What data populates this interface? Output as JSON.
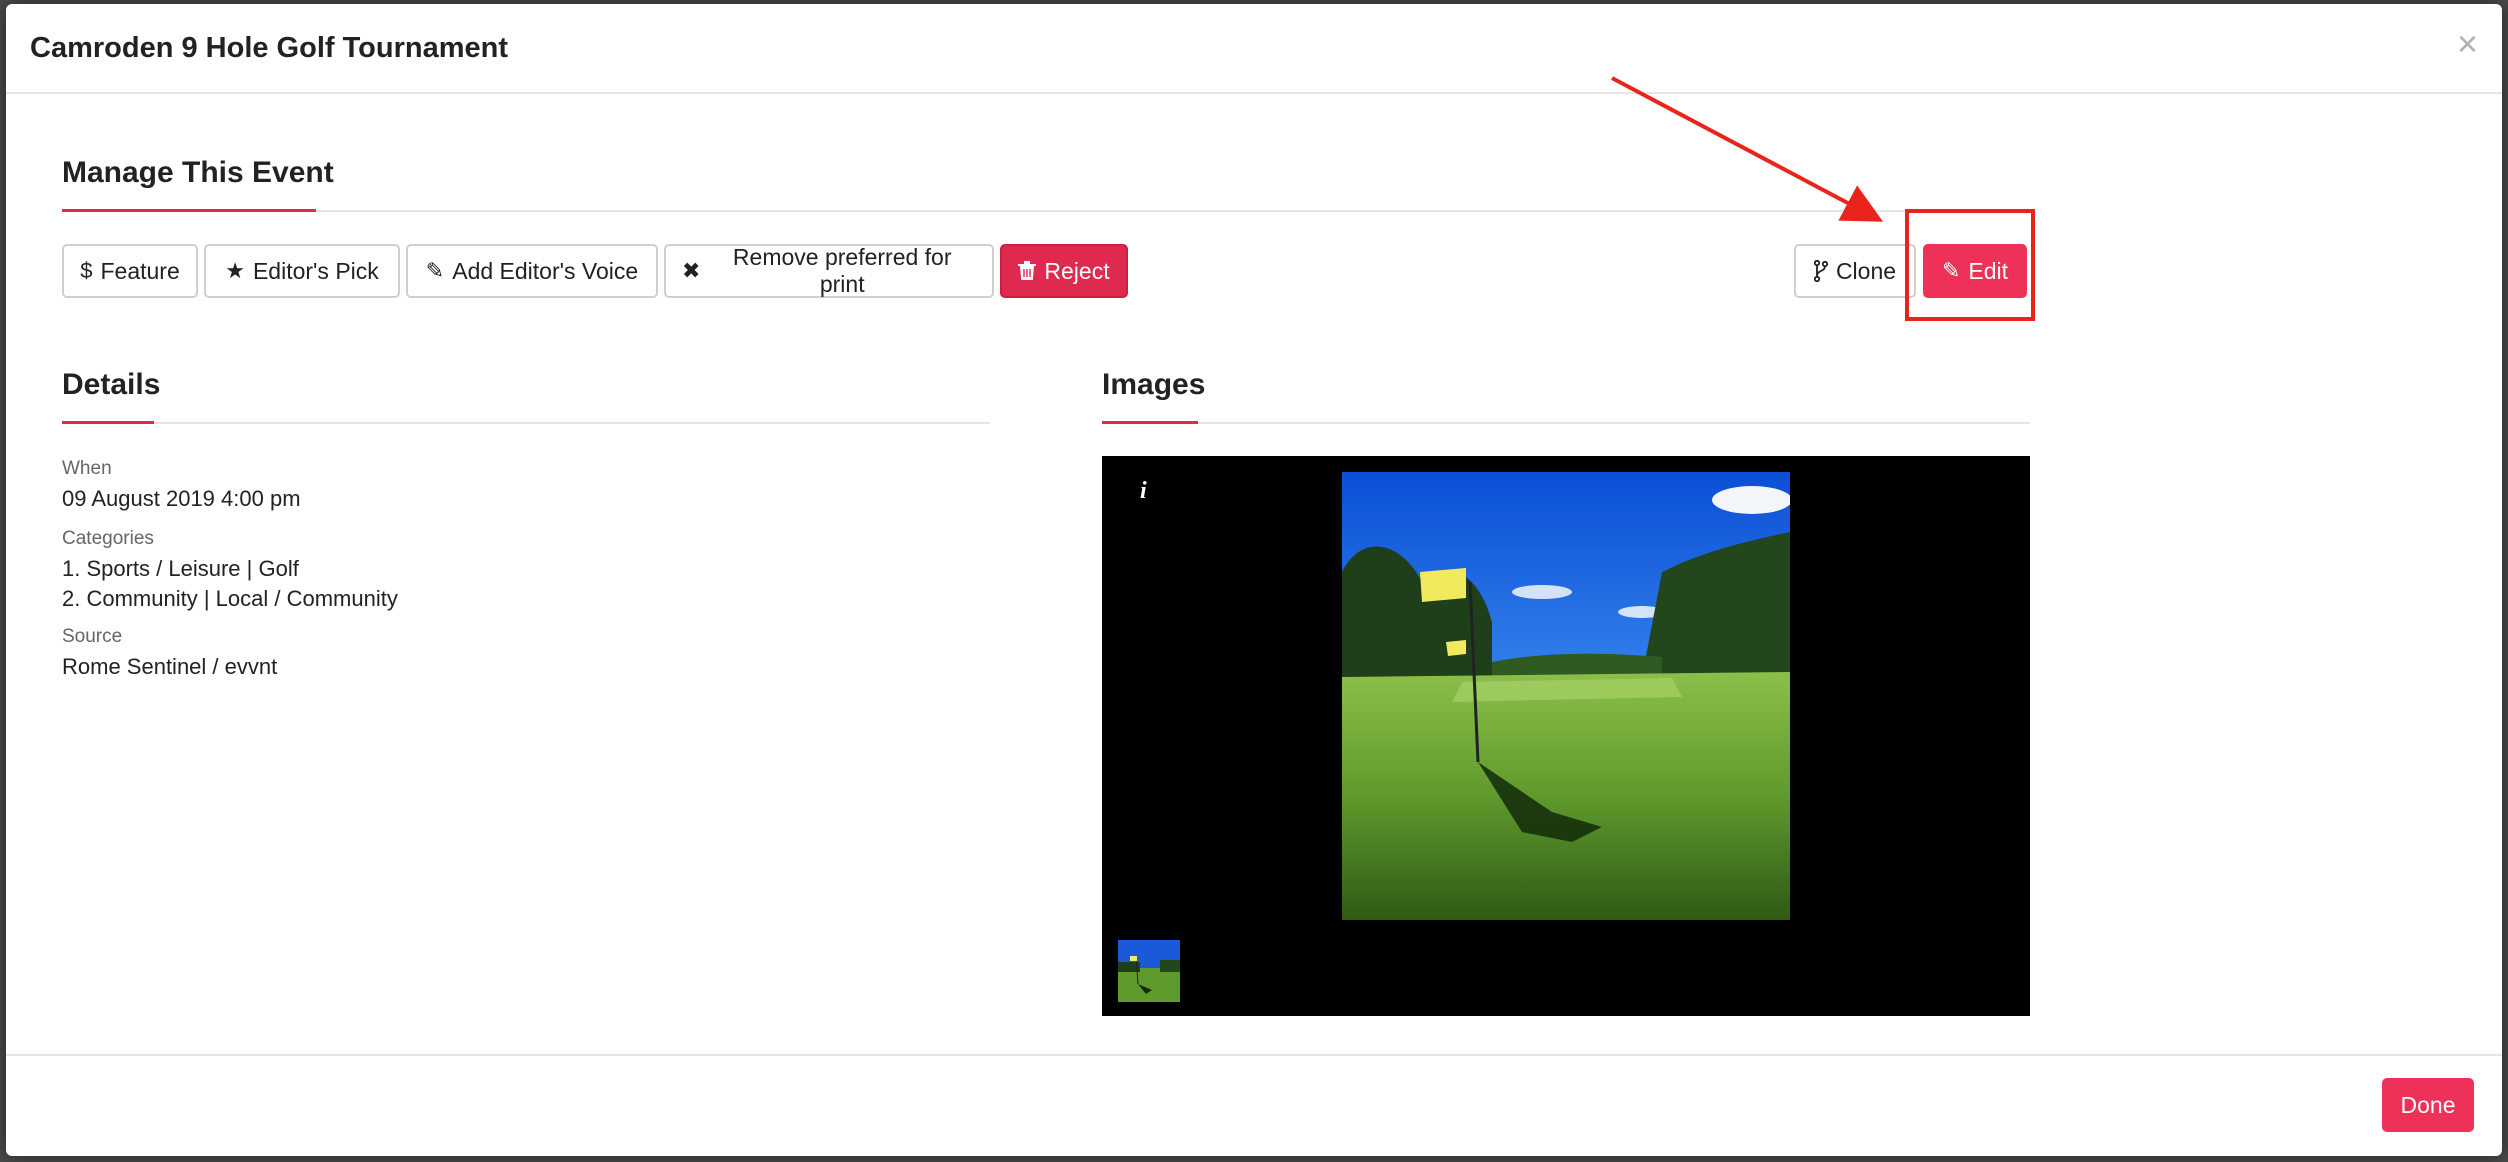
{
  "modal": {
    "title": "Camroden 9 Hole Golf Tournament",
    "close_glyph": "×"
  },
  "manage": {
    "title": "Manage This Event",
    "buttons": {
      "feature": {
        "icon": "dollar-icon",
        "label": "Feature"
      },
      "editors_pick": {
        "icon": "star-icon",
        "label": "Editor's Pick"
      },
      "add_editors_voice": {
        "icon": "pencil-icon",
        "label": "Add Editor's Voice"
      },
      "remove_preferred": {
        "icon": "times-icon",
        "label": "Remove preferred for print"
      },
      "reject": {
        "icon": "trash-icon",
        "label": "Reject"
      },
      "clone": {
        "icon": "code-fork-icon",
        "label": "Clone"
      },
      "edit": {
        "icon": "pencil-icon",
        "label": "Edit"
      }
    }
  },
  "details": {
    "title": "Details",
    "when_label": "When",
    "when_value": "09 August 2019 4:00 pm",
    "categories_label": "Categories",
    "categories": [
      "1. Sports / Leisure | Golf",
      "2. Community | Local / Community"
    ],
    "source_label": "Source",
    "source_value": "Rome Sentinel / evvnt"
  },
  "images": {
    "title": "Images",
    "info_glyph": "i",
    "photo_description_icon": "golf-green-photo",
    "thumbnails": 1
  },
  "footer": {
    "done_label": "Done"
  },
  "colors": {
    "accent": "#e0294f",
    "primary_button": "#ee3159",
    "annotation": "#e8241c"
  }
}
